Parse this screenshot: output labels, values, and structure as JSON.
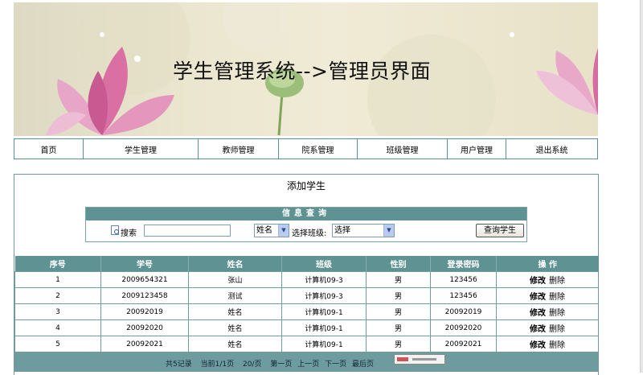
{
  "banner": {
    "title": "学生管理系统-->管理员界面"
  },
  "nav": [
    "首页",
    "学生管理",
    "教师管理",
    "院系管理",
    "班级管理",
    "用户管理",
    "退出系统"
  ],
  "page_title": "添加学生",
  "search": {
    "header": "信息查询",
    "label": "搜索",
    "field_select": "姓名",
    "class_label": "选择班级:",
    "class_select": "选择",
    "button": "查询学生"
  },
  "table": {
    "headers": [
      "序号",
      "学号",
      "姓名",
      "班级",
      "性别",
      "登录密码",
      "操 作"
    ],
    "rows": [
      [
        "1",
        "2009654321",
        "张山",
        "计算机09-3",
        "男",
        "123456"
      ],
      [
        "2",
        "2009123458",
        "测试",
        "计算机09-3",
        "男",
        "123456"
      ],
      [
        "3",
        "20092019",
        "姓名",
        "计算机09-1",
        "男",
        "20092019"
      ],
      [
        "4",
        "20092020",
        "姓名",
        "计算机09-1",
        "男",
        "20092020"
      ],
      [
        "5",
        "20092021",
        "姓名",
        "计算机09-1",
        "男",
        "20092021"
      ]
    ],
    "edit_label": "修改",
    "delete_label": "删除"
  },
  "pagination": {
    "records": "共5记录",
    "current": "当前1/1页",
    "per_page": "20/页",
    "first": "第一页",
    "prev": "上一页",
    "next": "下一页",
    "last": "最后页"
  },
  "colors": {
    "header": "#5f9292",
    "border": "#6e9c9e"
  }
}
